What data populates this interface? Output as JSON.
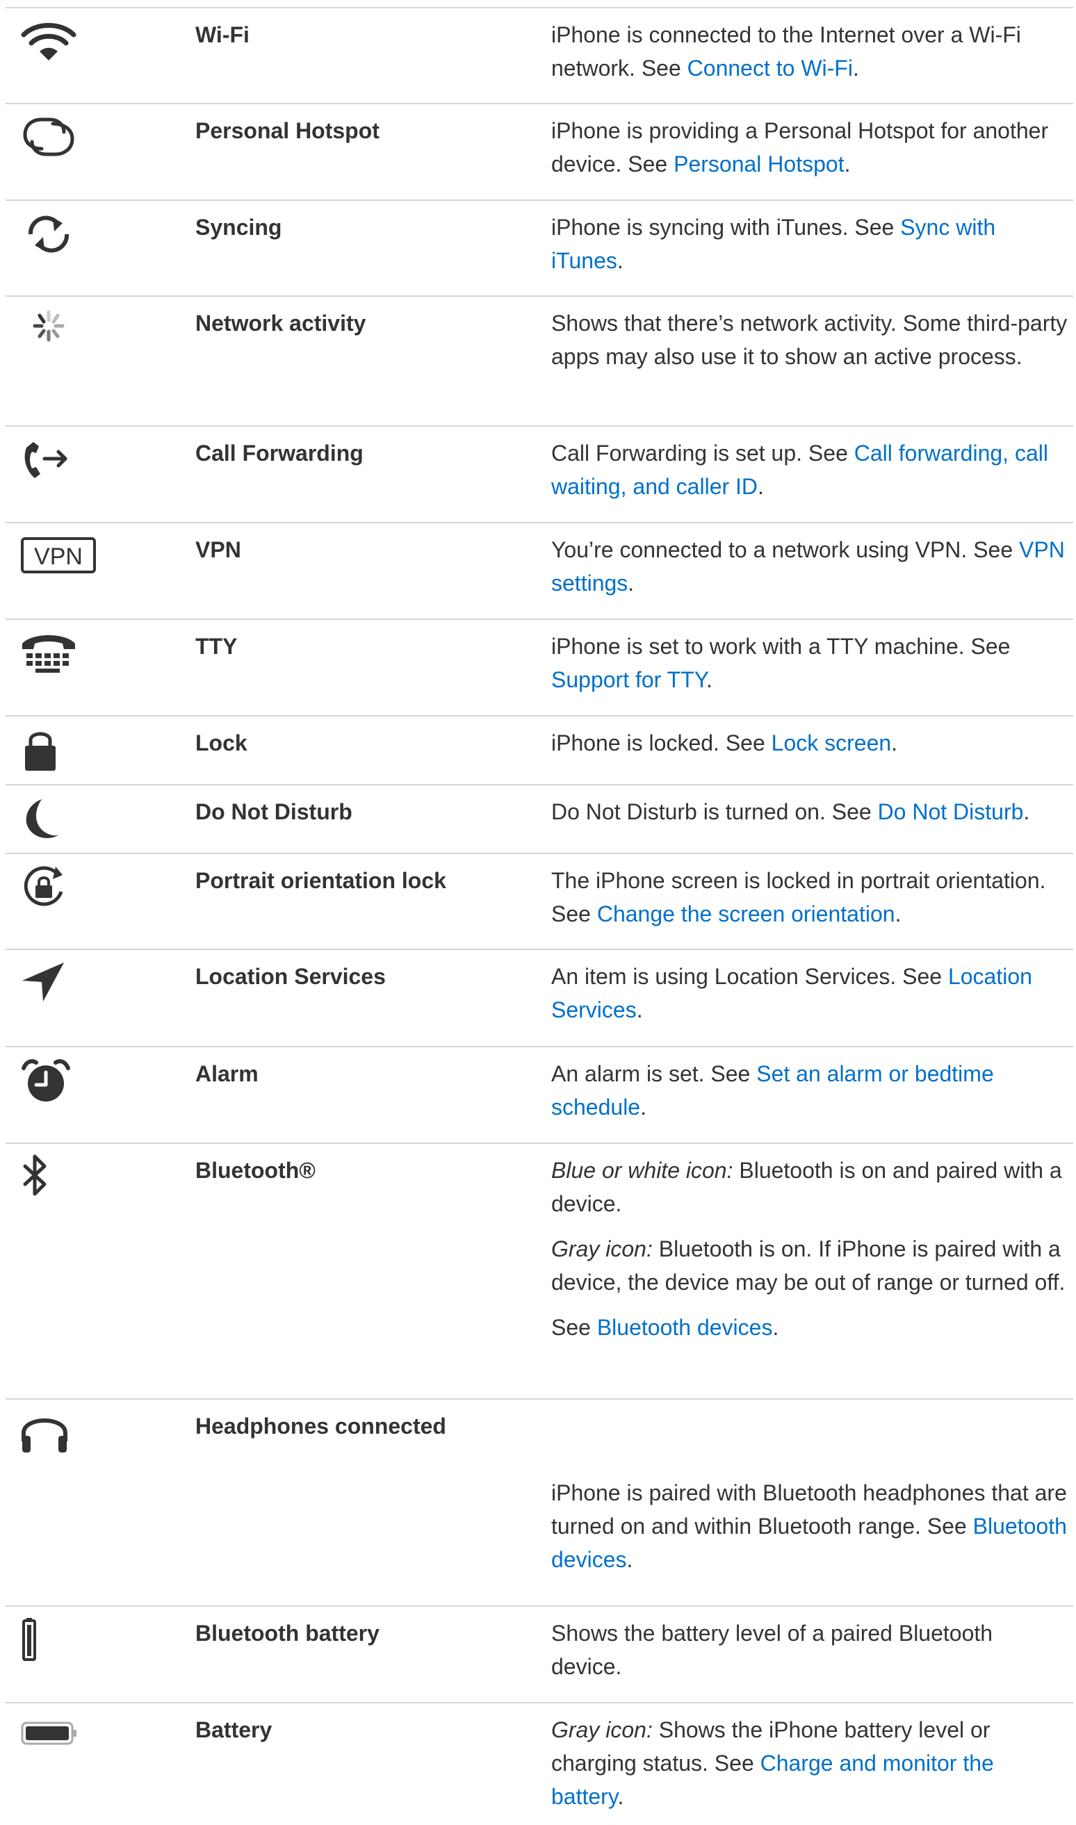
{
  "rows": [
    {
      "icon": "wifi-icon",
      "name": "Wi-Fi",
      "paras": [
        [
          {
            "t": "iPhone is connected to the Internet over a Wi-Fi network. See "
          },
          {
            "t": "Connect to Wi-Fi",
            "link": true
          },
          {
            "t": "."
          }
        ]
      ]
    },
    {
      "icon": "personal-hotspot-icon",
      "name": "Personal Hotspot",
      "paras": [
        [
          {
            "t": "iPhone is providing a Personal Hotspot for another device. See "
          },
          {
            "t": "Personal Hotspot",
            "link": true
          },
          {
            "t": "."
          }
        ]
      ]
    },
    {
      "icon": "syncing-icon",
      "name": "Syncing",
      "paras": [
        [
          {
            "t": "iPhone is syncing with iTunes. See "
          },
          {
            "t": "Sync with iTunes",
            "link": true
          },
          {
            "t": "."
          }
        ]
      ]
    },
    {
      "icon": "network-activity-icon",
      "name": "Network activity",
      "paras": [
        [
          {
            "t": "Shows that there’s network activity. Some third-party apps may also use it to show an active process."
          }
        ]
      ]
    },
    {
      "icon": "call-forwarding-icon",
      "name": "Call Forwarding",
      "paras": [
        [
          {
            "t": "Call Forwarding is set up. See "
          },
          {
            "t": "Call forwarding, call waiting, and caller ID",
            "link": true
          },
          {
            "t": "."
          }
        ]
      ]
    },
    {
      "icon": "vpn-icon",
      "icon_text": "VPN",
      "name": "VPN",
      "paras": [
        [
          {
            "t": "You’re connected to a network using VPN. See "
          },
          {
            "t": "VPN settings",
            "link": true
          },
          {
            "t": "."
          }
        ]
      ]
    },
    {
      "icon": "tty-icon",
      "name": "TTY",
      "paras": [
        [
          {
            "t": "iPhone is set to work with a TTY machine. See "
          },
          {
            "t": "Support for TTY",
            "link": true
          },
          {
            "t": "."
          }
        ]
      ]
    },
    {
      "icon": "lock-icon",
      "name": "Lock",
      "paras": [
        [
          {
            "t": "iPhone is locked. See "
          },
          {
            "t": "Lock screen",
            "link": true
          },
          {
            "t": "."
          }
        ]
      ]
    },
    {
      "icon": "moon-icon",
      "name": "Do Not Disturb",
      "paras": [
        [
          {
            "t": "Do Not Disturb is turned on. See "
          },
          {
            "t": "Do Not Disturb",
            "link": true
          },
          {
            "t": "."
          }
        ]
      ]
    },
    {
      "icon": "orientation-lock-icon",
      "name": "Portrait orientation lock",
      "paras": [
        [
          {
            "t": "The iPhone screen is locked in portrait orientation. See "
          },
          {
            "t": "Change the screen orientation",
            "link": true
          },
          {
            "t": "."
          }
        ]
      ]
    },
    {
      "icon": "location-arrow-icon",
      "name": "Location Services",
      "paras": [
        [
          {
            "t": "An item is using Location Services. See "
          },
          {
            "t": "Location Services",
            "link": true
          },
          {
            "t": "."
          }
        ]
      ]
    },
    {
      "icon": "alarm-clock-icon",
      "name": "Alarm",
      "paras": [
        [
          {
            "t": "An alarm is set. See "
          },
          {
            "t": "Set an alarm or bedtime schedule",
            "link": true
          },
          {
            "t": "."
          }
        ]
      ]
    },
    {
      "icon": "bluetooth-icon",
      "name": "Bluetooth®",
      "paras": [
        [
          {
            "t": "Blue or white icon:",
            "italic": true
          },
          {
            "t": " Bluetooth is on and paired with a device."
          }
        ],
        [
          {
            "t": "Gray icon:",
            "italic": true
          },
          {
            "t": " Bluetooth is on. If iPhone is paired with a device, the device may be out of range or turned off."
          }
        ],
        [
          {
            "t": "See "
          },
          {
            "t": "Bluetooth devices",
            "link": true
          },
          {
            "t": "."
          }
        ]
      ]
    },
    {
      "icon": "headphones-icon",
      "name": "Headphones connected",
      "paras": [
        [
          {
            "t": "iPhone is paired with Bluetooth headphones that are turned on and within Bluetooth range. See "
          },
          {
            "t": "Bluetooth devices",
            "link": true
          },
          {
            "t": "."
          }
        ]
      ]
    },
    {
      "icon": "bluetooth-battery-icon",
      "name": "Bluetooth battery",
      "paras": [
        [
          {
            "t": "Shows the battery level of a paired Bluetooth device."
          }
        ]
      ]
    },
    {
      "icon": "battery-icon",
      "name": "Battery",
      "paras": [
        [
          {
            "t": "Gray icon:",
            "italic": true
          },
          {
            "t": " Shows the iPhone battery level or charging status. See "
          },
          {
            "t": "Charge and monitor the battery",
            "link": true
          },
          {
            "t": "."
          }
        ]
      ]
    }
  ]
}
